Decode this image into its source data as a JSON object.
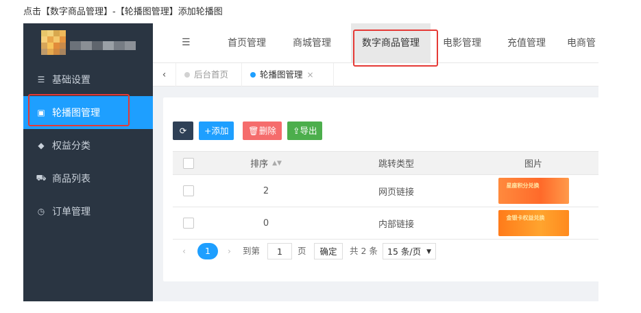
{
  "caption": "点击【数字商品管理】-【轮播图管理】添加轮播图",
  "sidebar": {
    "items": [
      {
        "label": "基础设置",
        "icon": "list-icon",
        "glyph": "☰"
      },
      {
        "label": "轮播图管理",
        "icon": "image-icon",
        "glyph": "▣"
      },
      {
        "label": "权益分类",
        "icon": "tag-icon",
        "glyph": "◆"
      },
      {
        "label": "商品列表",
        "icon": "cart-icon",
        "glyph": "⛟"
      },
      {
        "label": "订单管理",
        "icon": "clock-icon",
        "glyph": "◷"
      }
    ]
  },
  "topnav": {
    "toggle_glyph": "☰",
    "tabs": [
      "首页管理",
      "商城管理",
      "数字商品管理",
      "电影管理",
      "充值管理",
      "电商管"
    ]
  },
  "pagebar": {
    "back_glyph": "‹",
    "tabs": [
      "后台首页",
      "轮播图管理"
    ],
    "close_glyph": "×"
  },
  "toolbar": {
    "refresh_glyph": "⟳",
    "add_label": "+添加",
    "delete_label": "🗑删除",
    "export_label": "⇪导出"
  },
  "table": {
    "columns": [
      "排序",
      "跳转类型",
      "图片"
    ],
    "sort_glyph": "▲▼",
    "rows": [
      {
        "sort": "2",
        "type": "网页链接",
        "banner_text": "星座积分兑换"
      },
      {
        "sort": "0",
        "type": "内部链接",
        "banner_text": "金银卡权益兑换"
      }
    ]
  },
  "pager": {
    "prev": "‹",
    "current": "1",
    "next": "›",
    "goto_label": "到第",
    "input_value": "1",
    "page_label": "页",
    "confirm_label": "确定",
    "total_label": "共 2 条",
    "page_size": "15 条/页",
    "size_arrow": "▼"
  },
  "colors": {
    "accent": "#1e9fff",
    "sidebar_bg": "#2a3542",
    "highlight": "#e53935"
  }
}
